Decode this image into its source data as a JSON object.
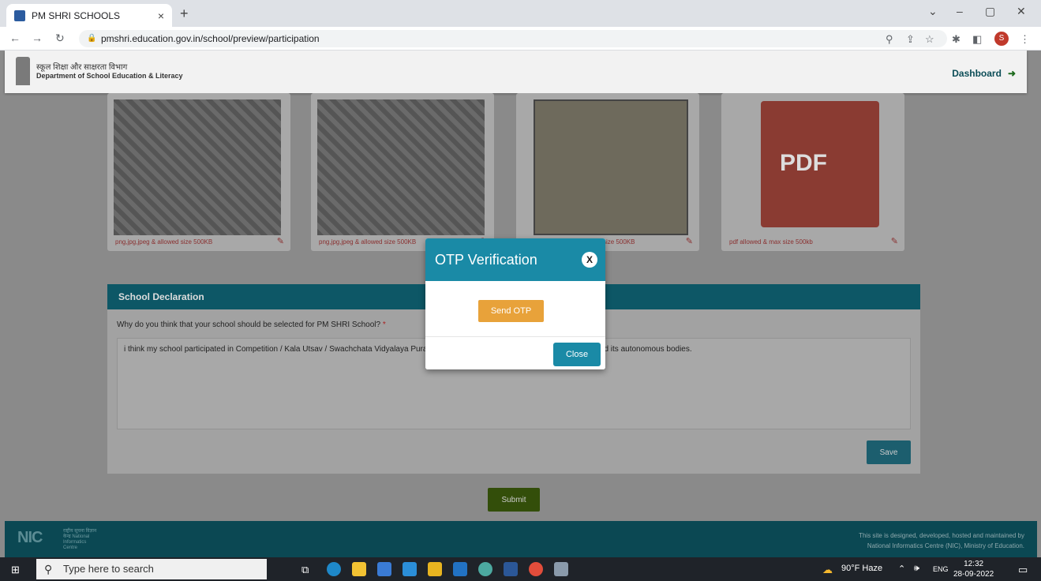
{
  "browser": {
    "tab_title": "PM SHRI SCHOOLS",
    "tab_close": "×",
    "new_tab": "+",
    "url": "pmshri.education.gov.in/school/preview/participation",
    "profile_initial": "S"
  },
  "header": {
    "dept_hindi": "स्कूल शिक्षा और साक्षरता विभाग",
    "dept_english": "Department of School Education & Literacy",
    "dashboard_label": "Dashboard"
  },
  "uploads": [
    {
      "hint": "png,jpg,jpeg & allowed size 500KB"
    },
    {
      "hint": "png,jpg,jpeg & allowed size 500KB"
    },
    {
      "hint": "size 500KB"
    },
    {
      "hint": "pdf allowed & max size 500kb"
    }
  ],
  "pdf_label": "PDF",
  "declaration": {
    "heading": "School Declaration",
    "question": "Why do you think that your school should be selected for PM SHRI School?",
    "required_mark": "*",
    "answer": "i think my school participated in Competition / Kala Utsav / Swachchata Vidyalaya Puraskar ... National level competitions held by MoE and its autonomous bodies.",
    "save_label": "Save"
  },
  "submit_label": "Submit",
  "footer": {
    "nic_logo": "NIC",
    "nic_sub": "राष्ट्रीय सूचना विज्ञान केन्द्र National Informatics Centre",
    "line1": "This site is designed, developed, hosted and maintained by",
    "line2": "National Informatics Centre (NIC), Ministry of Education."
  },
  "modal": {
    "title": "OTP Verification",
    "close_x": "X",
    "send_otp_label": "Send OTP",
    "close_label": "Close"
  },
  "taskbar": {
    "search_placeholder": "Type here to search",
    "weather": "90°F  Haze",
    "language": "ENG",
    "time": "12:32",
    "date": "28-09-2022"
  }
}
